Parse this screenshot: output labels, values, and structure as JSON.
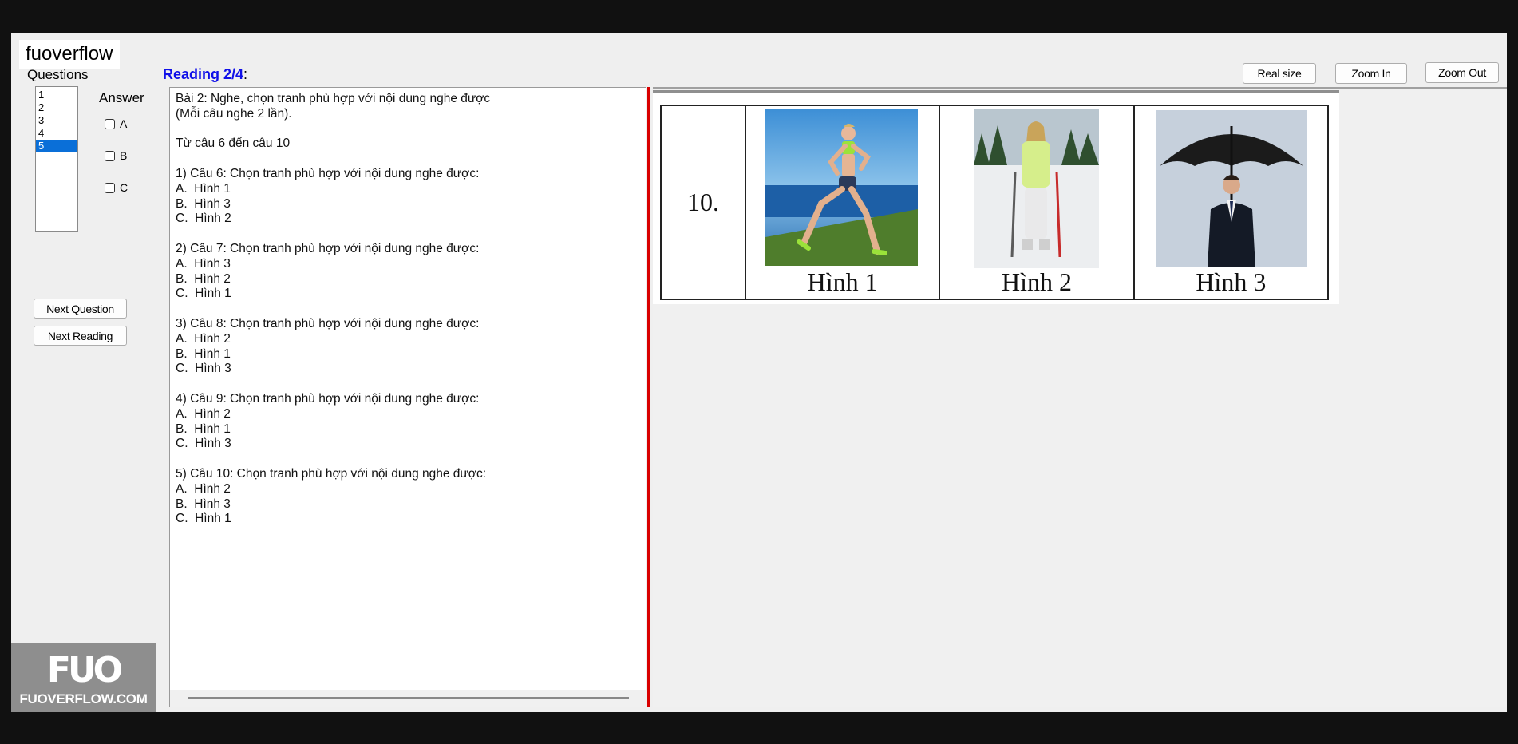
{
  "watermark": "fuoverflow",
  "labels": {
    "questions": "Questions",
    "answer": "Answer"
  },
  "reading": {
    "title": "Reading 2/4",
    "colon": ":"
  },
  "question_list": {
    "items": [
      "1",
      "2",
      "3",
      "4",
      "5"
    ],
    "selected": "5"
  },
  "answers": [
    "A",
    "B",
    "C"
  ],
  "buttons": {
    "next_question": "Next Question",
    "next_reading": "Next Reading",
    "real_size": "Real size",
    "zoom_in": "Zoom In",
    "zoom_out": "Zoom Out"
  },
  "reading_text": "Bài 2: Nghe, chọn tranh phù hợp với nội dung nghe được\n(Mỗi câu nghe 2 lần).\n\nTừ câu 6 đến câu 10\n\n1) Câu 6: Chọn tranh phù hợp với nội dung nghe được:\nA.  Hình 1\nB.  Hình 3\nC.  Hình 2\n\n2) Câu 7: Chọn tranh phù hợp với nội dung nghe được:\nA.  Hình 3\nB.  Hình 2\nC.  Hình 1\n\n3) Câu 8: Chọn tranh phù hợp với nội dung nghe được:\nA.  Hình 2\nB.  Hình 1\nC.  Hình 3\n\n4) Câu 9: Chọn tranh phù hợp với nội dung nghe được:\nA.  Hình 2\nB.  Hình 1\nC.  Hình 3\n\n5) Câu 10: Chọn tranh phù hợp với nội dung nghe được:\nA.  Hình 2\nB.  Hình 3\nC.  Hình 1",
  "image": {
    "number": "10.",
    "pictures": [
      {
        "label": "Hình 1",
        "icon": "runner-photo"
      },
      {
        "label": "Hình 2",
        "icon": "skier-photo"
      },
      {
        "label": "Hình 3",
        "icon": "umbrella-man-photo"
      }
    ]
  },
  "logo": {
    "mark": "FUO",
    "text": "FUOVERFLOW.COM"
  },
  "colors": {
    "accent": "#1010e8",
    "selected": "#0a6fd8",
    "divider": "#d90000"
  }
}
